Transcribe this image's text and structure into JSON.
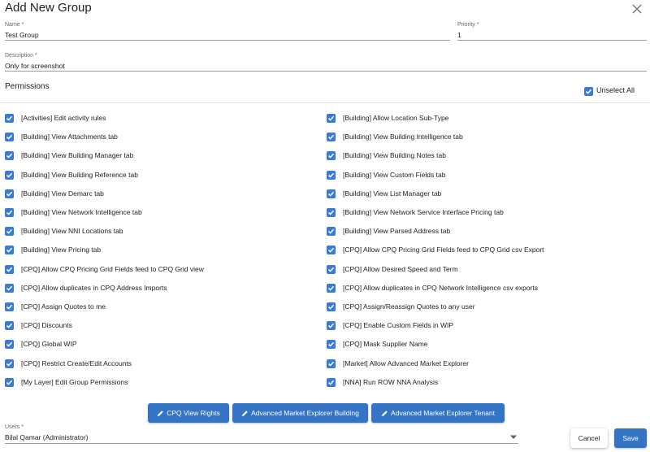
{
  "dialog": {
    "title": "Add New Group"
  },
  "form": {
    "name": {
      "label": "Name *",
      "value": "Test Group"
    },
    "priority": {
      "label": "Priority *",
      "value": "1"
    },
    "description": {
      "label": "Description *",
      "value": "Only for screenshot"
    },
    "users": {
      "label": "Users *",
      "value": "Bilal Qamar (Administrator)"
    }
  },
  "permissions": {
    "title": "Permissions",
    "unselect_all_label": "Unselect All",
    "unselect_all_checked": true,
    "left": [
      "[Activities] Edit activity rules",
      "[Building] View Attachments tab",
      "[Building] View Building Manager tab",
      "[Building] View Building Reference tab",
      "[Building] View Demarc tab",
      "[Building] View Network Intelligence tab",
      "[Building] View NNI Locations tab",
      "[Building] View Pricing tab",
      "[CPQ] Allow CPQ Pricing Grid Fields feed to CPQ Grid view",
      "[CPQ] Allow duplicates in CPQ Address Imports",
      "[CPQ] Assign Quotes to me",
      "[CPQ] Discounts",
      "[CPQ] Global WIP",
      "[CPQ] Restrict Create/Edit Accounts",
      "[My Layer] Edit Group Permissions"
    ],
    "right": [
      "[Building] Allow Location Sub-Type",
      "[Building] View Building Intelligence tab",
      "[Building] View Building Notes tab",
      "[Building] View Custom Fields tab",
      "[Building] View List Manager tab",
      "[Building] View Network Service Interface Pricing tab",
      "[Building] View Parsed Address tab",
      "[CPQ] Allow CPQ Pricing Grid Fields feed to CPQ Grid csv Export",
      "[CPQ] Allow Desired Speed and Term",
      "[CPQ] Allow duplicates in CPQ Network Intelligence csv exports",
      "[CPQ] Assign/Reassign Quotes to any user",
      "[CPQ] Enable Custom Fields in WIP",
      "[CPQ] Mask Supplier Name",
      "[Market] Allow Advanced Market Explorer",
      "[NNA] Run ROW NNA Analysis"
    ],
    "all_checked": true
  },
  "rights_buttons": [
    {
      "label": "CPQ View Rights",
      "icon": "pencil-icon"
    },
    {
      "label": "Advanced Market Explorer Building",
      "icon": "pencil-icon"
    },
    {
      "label": "Advanced Market Explorer Tenant",
      "icon": "pencil-icon"
    }
  ],
  "actions": {
    "cancel_label": "Cancel",
    "save_label": "Save"
  },
  "colors": {
    "primary": "#3474c4",
    "checkbox": "#3a7bd5"
  }
}
